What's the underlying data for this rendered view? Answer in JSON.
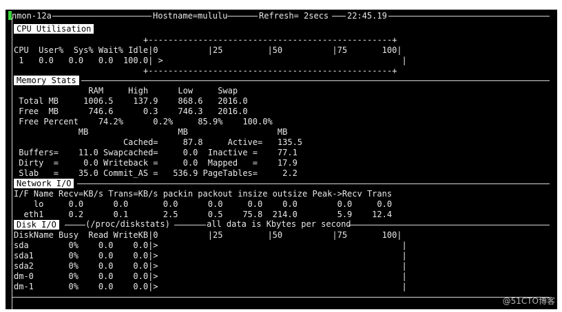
{
  "header": {
    "program": "nmon-12a",
    "hostname": "Hostname=mululu",
    "refresh": "Refresh= 2secs",
    "time": "22:45.19"
  },
  "cpu": {
    "section_title": "CPU Utilisation",
    "scale_top": "+-------------------------------------------------+",
    "header_line": "CPU  User%  Sys% Wait% Idle|0          |25         |50          |75       100|",
    "row_line": " 1   0.0   0.0   0.0  100.0| >                                                |",
    "scale_bottom": "+-------------------------------------------------+"
  },
  "memory": {
    "section_title": "Memory Stats",
    "lines": [
      "               RAM     High      Low     Swap",
      " Total MB     1006.5    137.9    868.6   2016.0",
      " Free  MB      746.6      0.3    746.3   2016.0",
      " Free Percent    74.2%      0.2%     85.9%    100.0%",
      "             MB                  MB                  MB",
      "                      Cached=     87.8     Active=   135.5",
      " Buffers=    11.0 Swapcached=     0.0  Inactive =    77.1",
      " Dirty  =     0.0 Writeback =     0.0  Mapped   =    17.9",
      " Slab   =    35.0 Commit_AS =   536.9 PageTables=     2.2"
    ]
  },
  "network": {
    "section_title": "Network I/O",
    "lines": [
      "I/F Name Recv=KB/s Trans=KB/s packin packout insize outsize Peak->Recv Trans",
      "    lo     0.0      0.0       0.0      0.0     0.0    0.0        0.0     0.0",
      "  eth1     0.2      0.1       2.5      0.5    75.8  214.0        5.9    12.4"
    ]
  },
  "disk": {
    "section_title": "Disk I/O",
    "subtitle": "(/proc/diskstats)",
    "subtitle_note": "all data is Kbytes per second",
    "header_line": "DiskName Busy  Read WriteKB|0          |25         |50          |75       100|",
    "rows": [
      "sda        0%    0.0    0.0|>                                                 |",
      "sda1       0%    0.0    0.0|>                                                 |",
      "sda2       0%    0.0    0.0|>                                                 |",
      "dm-0       0%    0.0    0.0|>                                                 |",
      "dm-1       0%    0.0    0.0|>                                                 |"
    ]
  },
  "watermark": "@51CTO博客",
  "colors": {
    "terminal_bg": "#000000",
    "text": "#e8e8e8",
    "section_bg": "#ffffff",
    "cursor": "#3cd43c"
  }
}
